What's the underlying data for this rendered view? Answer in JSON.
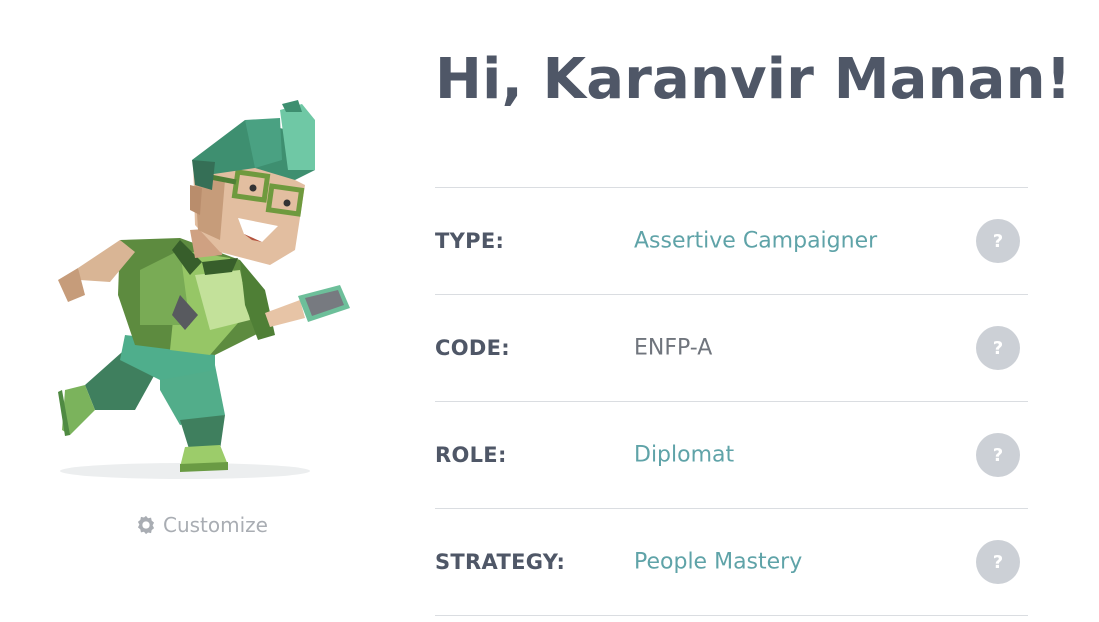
{
  "greeting": "Hi, Karanvir Manan!",
  "customize_label": "Customize",
  "rows": [
    {
      "label": "TYPE:",
      "value": "Assertive Campaigner",
      "help": "?"
    },
    {
      "label": "CODE:",
      "value": "ENFP-A",
      "help": "?"
    },
    {
      "label": "ROLE:",
      "value": "Diplomat",
      "help": "?"
    },
    {
      "label": "STRATEGY:",
      "value": "People Mastery",
      "help": "?"
    }
  ],
  "colors": {
    "accent": "#5fa3a8",
    "heading": "#4f5767",
    "help_button": "#ccd0d6",
    "divider": "#dadde1"
  },
  "icons": {
    "customize": "gear-icon",
    "avatar": "avatar-illustration"
  }
}
